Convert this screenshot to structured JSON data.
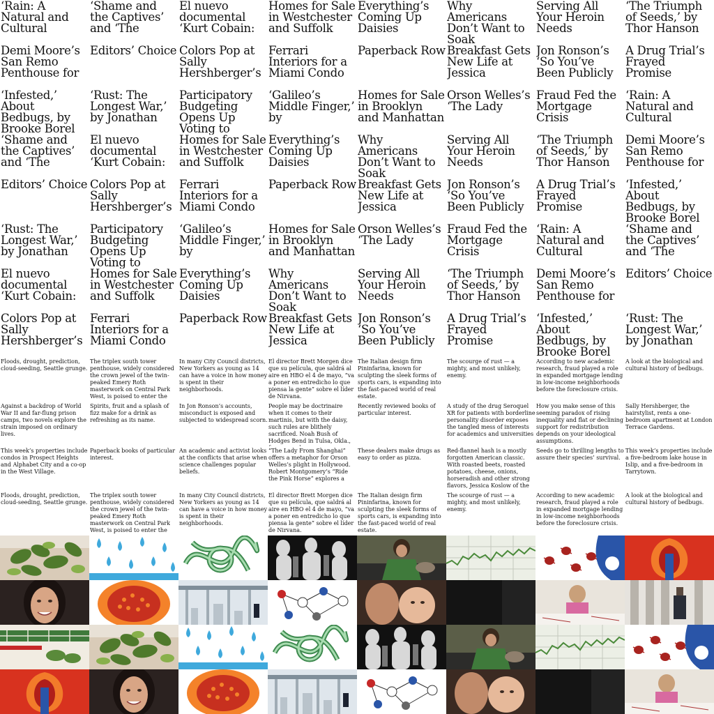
{
  "headlines": [
    "‘Rain: A Natural and Cultural",
    "‘Shame and the Captives’ and ‘The",
    "El nuevo documental ‘Kurt Cobain:",
    "Homes for Sale in Westchester and Suffolk",
    "Everything’s Coming Up Daisies",
    "Why Americans Don’t Want to Soak",
    "Serving All Your Heroin Needs",
    "‘The Triumph of Seeds,’ by Thor Hanson",
    "Demi Moore’s San Remo Penthouse for",
    "Editors’ Choice",
    "Colors Pop at Sally Hershberger’s",
    "Ferrari Interiors for a Miami Condo",
    "Paperback Row",
    "Breakfast Gets New Life at Jessica",
    "Jon Ronson’s ‘So You’ve Been Publicly",
    "A Drug Trial’s Frayed Promise",
    "‘Infested,’ About Bedbugs, by Brooke Borel",
    "‘Rust: The Longest War,’ by Jonathan",
    "Participatory Budgeting Opens Up Voting to",
    "‘Galileo’s Middle Finger,’ by",
    "Homes for Sale in Brooklyn and Manhattan",
    "Orson Welles’s ‘The Lady",
    "Fraud Fed the Mortgage Crisis",
    "‘Rain: A Natural and Cultural",
    "‘Shame and the Captives’ and ‘The",
    "El nuevo documental ‘Kurt Cobain:",
    "Homes for Sale in Westchester and Suffolk",
    "Everything’s Coming Up Daisies",
    "Why Americans Don’t Want to Soak",
    "Serving All Your Heroin Needs",
    "‘The Triumph of Seeds,’ by Thor Hanson",
    "Demi Moore’s San Remo Penthouse for",
    "Editors’ Choice",
    "Colors Pop at Sally Hershberger’s",
    "Ferrari Interiors for a Miami Condo",
    "Paperback Row",
    "Breakfast Gets New Life at Jessica",
    "Jon Ronson’s ‘So You’ve Been Publicly",
    "A Drug Trial’s Frayed Promise",
    "‘Infested,’ About Bedbugs, by Brooke Borel",
    "‘Rust: The Longest War,’ by Jonathan",
    "Participatory Budgeting Opens Up Voting to",
    "‘Galileo’s Middle Finger,’ by",
    "Homes for Sale in Brooklyn and Manhattan",
    "Orson Welles’s ‘The Lady",
    "Fraud Fed the Mortgage Crisis",
    "‘Rain: A Natural and Cultural",
    "‘Shame and the Captives’ and ‘The",
    "El nuevo documental ‘Kurt Cobain:",
    "Homes for Sale in Westchester and Suffolk",
    "Everything’s Coming Up Daisies",
    "Why Americans Don’t Want to Soak",
    "Serving All Your Heroin Needs",
    "‘The Triumph of Seeds,’ by Thor Hanson",
    "Demi Moore’s San Remo Penthouse for",
    "Editors’ Choice",
    "Colors Pop at Sally Hershberger’s",
    "Ferrari Interiors for a Miami Condo",
    "Paperback Row",
    "Breakfast Gets New Life at Jessica",
    "Jon Ronson’s ‘So You’ve Been Publicly",
    "A Drug Trial’s Frayed Promise",
    "‘Infested,’ About Bedbugs, by Brooke Borel",
    "‘Rust: The Longest War,’ by Jonathan"
  ],
  "summaries": [
    "Floods, drought, prediction, cloud-seeding, Seattle grunge.",
    "The triplex south tower penthouse, widely considered the crown jewel of the twin-peaked Emery Roth masterwork on Central Park West, is poised to enter the",
    "In many City Council districts, New Yorkers as young as 14 can have a voice in how money is spent in their neighborhoods.",
    "El director Brett Morgen dice que su película, que saldrá al aire en HBO el 4 de mayo, “va a poner en entredicho lo que piensa la gente” sobre el líder de Nirvana.",
    "The Italian design firm Pininfarina, known for sculpting the sleek forms of sports cars, is expanding into the fast-paced world of real estate.",
    "The scourge of rust — a mighty, and most unlikely, enemy.",
    "According to new academic research, fraud played a role in expanded mortgage lending in low-income neighborhoods before the foreclosure crisis.",
    "A look at the biological and cultural history of bedbugs.",
    "Against a backdrop of World War II and far-flung prison camps, two novels explore the strain imposed on ordinary lives.",
    "Spirits, fruit and a splash of fizz make for a drink as refreshing as its name.",
    "In Jon Ronson’s accounts, misconduct is exposed and subjected to widespread scorn.",
    "People may be doctrinaire when it comes to their martinis, but with the daisy, such rules are blithely sacrificed. Noah Bush of Hodges Bend in Tulsa, Okla., forgoes soda — a",
    "Recently reviewed books of particular interest.",
    "A study of the drug Seroquel XR for patients with borderline personality disorder exposes the tangled mess of interests for academics and universities",
    "How you make sense of this seeming paradox of rising inequality and flat or declining support for redistribution depends on your ideological assumptions.",
    "Sally Hershberger, the hairstylist, rents a one-bedroom apartment at London Terrace Gardens.",
    "This week’s properties include condos in Prospect Heights and Alphabet City and a co-op in the West Village.",
    "Paperback books of particular interest.",
    "An academic and activist looks at the conflicts that arise when science challenges popular beliefs.",
    "“The Lady From Shanghai” offers a metaphor for Orson Welles’s plight in Hollywood. Robert Montgomery’s “Ride the Pink Horse” explores a",
    "These dealers make drugs as easy to order as pizza.",
    "Red-flannel hash is a mostly forgotten American classic. With roasted beets, roasted potatoes, cheese, onions, horseradish and other strong flavors, Jessica Koslow of the",
    "Seeds go to thrilling lengths to assure their species’ survival.",
    "This week’s properties include a five-bedroom lake house in Islip, and a five-bedroom in Tarrytown.",
    "Floods, drought, prediction, cloud-seeding, Seattle grunge.",
    "The triplex south tower penthouse, widely considered the crown jewel of the twin-peaked Emery Roth masterwork on Central Park West, is poised to enter the",
    "In many City Council districts, New Yorkers as young as 14 can have a voice in how money is spent in their neighborhoods.",
    "El director Brett Morgen dice que su película, que saldrá al aire en HBO el 4 de mayo, “va a poner en entredicho lo que piensa la gente” sobre el líder de Nirvana.",
    "The Italian design firm Pininfarina, known for sculpting the sleek forms of sports cars, is expanding into the fast-paced world of real estate.",
    "The scourge of rust — a mighty, and most unlikely, enemy.",
    "According to new academic research, fraud played a role in expanded mortgage lending in low-income neighborhoods before the foreclosure crisis.",
    "A look at the biological and cultural history of bedbugs."
  ],
  "images": [
    {
      "name": "basil-jar-photo"
    },
    {
      "name": "rain-drops-illustration"
    },
    {
      "name": "green-knot-illustration"
    },
    {
      "name": "dancers-photo"
    },
    {
      "name": "woman-with-cat-photo"
    },
    {
      "name": "stock-chart-image"
    },
    {
      "name": "bedbugs-illustration"
    },
    {
      "name": "red-seed-illustration"
    },
    {
      "name": "demi-moore-portrait"
    },
    {
      "name": "orange-seed-illustration"
    },
    {
      "name": "penthouse-terrace-photo"
    },
    {
      "name": "network-diagram-illustration"
    },
    {
      "name": "mother-and-baby-photo"
    },
    {
      "name": "dark-photo"
    },
    {
      "name": "child-at-table-photo"
    },
    {
      "name": "man-in-colonnade-photo"
    },
    {
      "name": "garden-illustration"
    },
    {
      "name": "basil-jar-photo"
    },
    {
      "name": "rain-drops-illustration"
    },
    {
      "name": "green-knot-illustration"
    },
    {
      "name": "dancers-photo"
    },
    {
      "name": "woman-with-cat-photo"
    },
    {
      "name": "stock-chart-image"
    },
    {
      "name": "bedbugs-illustration"
    },
    {
      "name": "red-seed-illustration"
    },
    {
      "name": "demi-moore-portrait"
    },
    {
      "name": "orange-seed-illustration"
    },
    {
      "name": "penthouse-terrace-photo"
    },
    {
      "name": "network-diagram-illustration"
    },
    {
      "name": "mother-and-baby-photo"
    },
    {
      "name": "dark-photo"
    },
    {
      "name": "child-at-table-photo"
    }
  ]
}
